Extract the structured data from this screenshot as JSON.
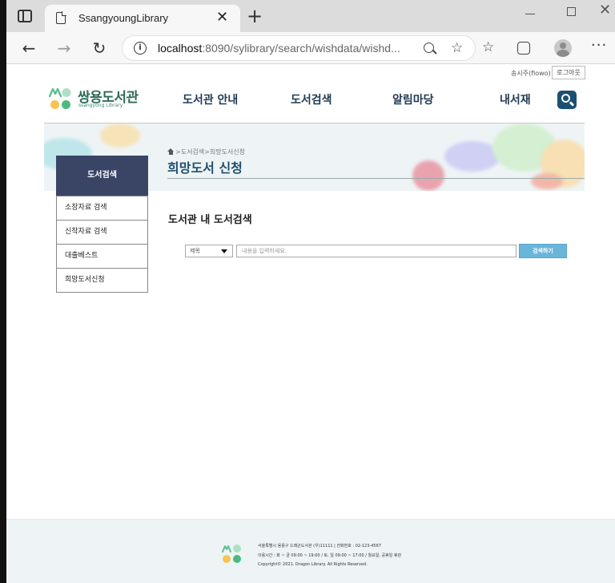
{
  "browser": {
    "tab_title": "SsangyoungLibrary",
    "url_host": "localhost",
    "url_rest": ":8090/sylibrary/search/wishdata/wishd..."
  },
  "header": {
    "user_info": "송시주(fiowo)",
    "logout_label": "로그아웃",
    "logo_title": "쌍용도서관",
    "logo_subtitle": "ssangyong Library",
    "nav": [
      "도서관 안내",
      "도서검색",
      "알림마당",
      "내서재"
    ]
  },
  "banner": {
    "breadcrumb": ">도서검색>희망도서신청",
    "title": "희망도서 신청"
  },
  "sidebar": {
    "heading": "도서검색",
    "items": [
      "소장자료 검색",
      "신착자료 검색",
      "대출베스트",
      "희망도서신청"
    ]
  },
  "main": {
    "title": "도서관 내 도서검색",
    "select_value": "제목",
    "search_placeholder": "내용을 입력하세요.",
    "search_button": "검색하기"
  },
  "footer": {
    "address": "서울특별시 용용구 드래곤도서관 (우)11111 | 전화번호 : 02-123-4567",
    "hours": "이용시간 : 화 ~ 금 09:00 ~ 19:00 / 토, 일 09:00 ~ 17:00 / 월요일, 공휴일 휴관",
    "copyright": "Copyright© 2021. Dragon Library. All Rights Reserved."
  },
  "colors": {
    "nav_text": "#1f3a55",
    "side_heading_bg": "#3a4566",
    "search_button_bg": "#6ab6da",
    "logo_text": "#2f6b5a"
  }
}
